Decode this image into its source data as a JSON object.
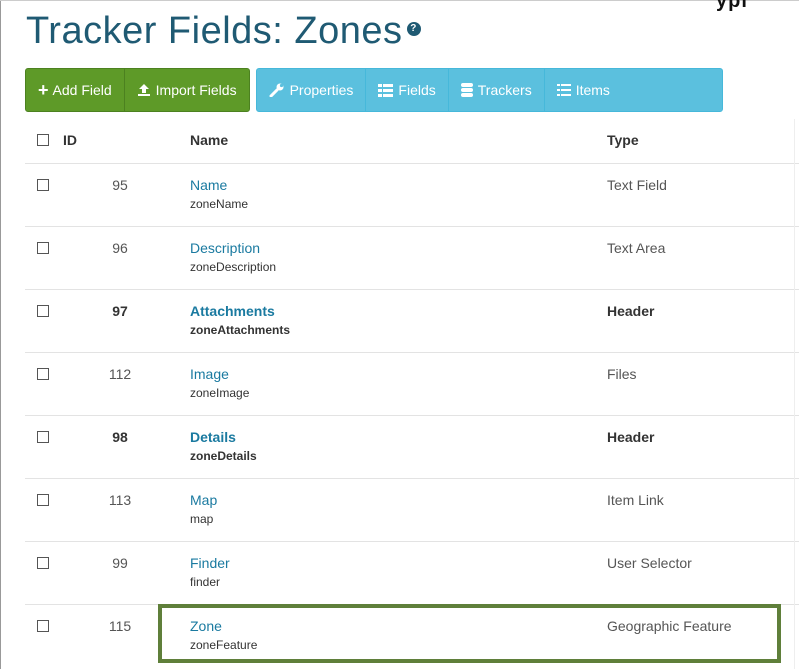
{
  "corner_text": "ypi",
  "page": {
    "title": "Tracker Fields: Zones",
    "help_icon": "question-circle-icon"
  },
  "toolbar": {
    "add_field": "Add Field",
    "import_fields": "Import Fields",
    "properties": "Properties",
    "fields": "Fields",
    "trackers": "Trackers",
    "items": "Items"
  },
  "colors": {
    "title": "#1f5a73",
    "green_button": "#5e9a28",
    "blue_button": "#5bc0de",
    "link": "#1a7aa0",
    "highlight": "#5f7f3a"
  },
  "table": {
    "headers": {
      "id": "ID",
      "name": "Name",
      "type": "Type"
    },
    "rows": [
      {
        "id": "95",
        "name": "Name",
        "perm": "zoneName",
        "type": "Text Field",
        "bold": false
      },
      {
        "id": "96",
        "name": "Description",
        "perm": "zoneDescription",
        "type": "Text Area",
        "bold": false
      },
      {
        "id": "97",
        "name": "Attachments",
        "perm": "zoneAttachments",
        "type": "Header",
        "bold": true
      },
      {
        "id": "112",
        "name": "Image",
        "perm": "zoneImage",
        "type": "Files",
        "bold": false
      },
      {
        "id": "98",
        "name": "Details",
        "perm": "zoneDetails",
        "type": "Header",
        "bold": true
      },
      {
        "id": "113",
        "name": "Map",
        "perm": "map",
        "type": "Item Link",
        "bold": false
      },
      {
        "id": "99",
        "name": "Finder",
        "perm": "finder",
        "type": "User Selector",
        "bold": false
      },
      {
        "id": "115",
        "name": "Zone",
        "perm": "zoneFeature",
        "type": "Geographic Feature",
        "bold": false
      }
    ]
  }
}
